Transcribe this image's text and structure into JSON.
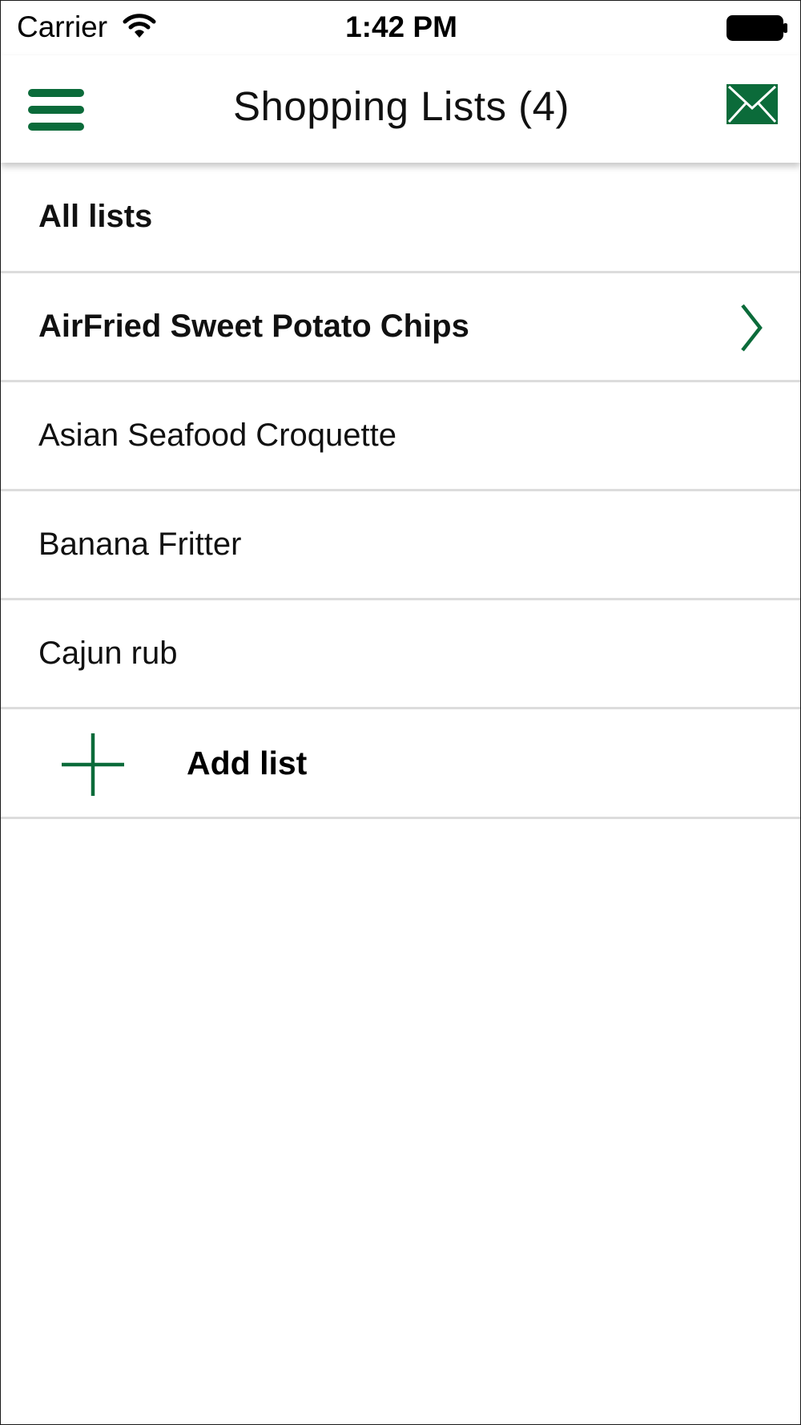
{
  "status_bar": {
    "carrier": "Carrier",
    "time": "1:42 PM"
  },
  "nav": {
    "title": "Shopping Lists (4)",
    "menu_icon": "hamburger-menu-icon",
    "mail_icon": "envelope-icon"
  },
  "lists": {
    "header": "All lists",
    "items": [
      {
        "label": "AirFried Sweet Potato Chips",
        "selected": true
      },
      {
        "label": "Asian Seafood Croquette",
        "selected": false
      },
      {
        "label": "Banana Fritter",
        "selected": false
      },
      {
        "label": "Cajun rub",
        "selected": false
      }
    ],
    "add_label": "Add list"
  },
  "colors": {
    "accent": "#0b6b3a",
    "divider": "#dcdcdc"
  }
}
